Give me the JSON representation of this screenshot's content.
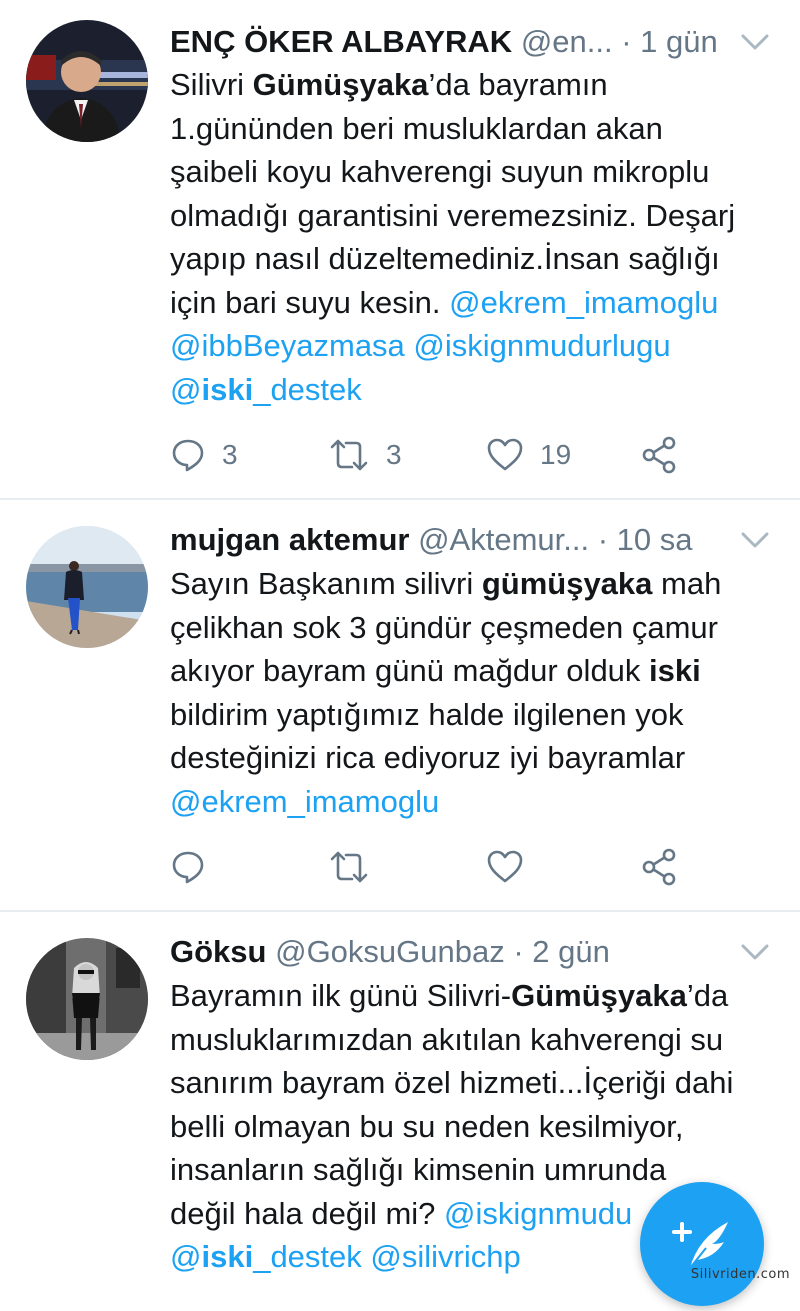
{
  "tweets": [
    {
      "name": "ENÇ ÖKER ALBAYRAK",
      "handle": "@en...",
      "time": "· 1 gün",
      "lines": [
        [
          {
            "t": "Silivri "
          },
          {
            "t": "Gümüşyaka",
            "s": "bold"
          },
          {
            "t": "’da bayramın"
          }
        ],
        [
          {
            "t": "1.gününden beri musluklardan akan"
          }
        ],
        [
          {
            "t": "şaibeli koyu kahverengi suyun mikroplu"
          }
        ],
        [
          {
            "t": "olmadığı garantisini veremezsiniz. Deşarj"
          }
        ],
        [
          {
            "t": "yapıp nasıl düzeltemediniz.İnsan sağlığı"
          }
        ],
        [
          {
            "t": "için bari suyu kesin. "
          },
          {
            "t": "@ekrem_imamoglu",
            "s": "link"
          }
        ],
        [
          {
            "t": "@ibbBeyazmasa @iskignmudurlugu",
            "s": "link"
          }
        ],
        [
          {
            "t": "@",
            "s": "link"
          },
          {
            "t": "iski",
            "s": "linkbold"
          },
          {
            "t": "_destek",
            "s": "link"
          }
        ]
      ],
      "replies": "3",
      "retweets": "3",
      "likes": "19"
    },
    {
      "name": "mujgan aktemur",
      "handle": "@Aktemur...",
      "time": "· 10 sa",
      "lines": [
        [
          {
            "t": "Sayın Başkanım silivri "
          },
          {
            "t": "gümüşyaka",
            "s": "bold"
          },
          {
            "t": " mah"
          }
        ],
        [
          {
            "t": "çelikhan sok 3 gündür çeşmeden çamur"
          }
        ],
        [
          {
            "t": "akıyor bayram günü mağdur olduk "
          },
          {
            "t": "iski",
            "s": "bold"
          }
        ],
        [
          {
            "t": "bildirim yaptığımız halde ilgilenen yok"
          }
        ],
        [
          {
            "t": "desteğinizi rica ediyoruz iyi bayramlar"
          }
        ],
        [
          {
            "t": "@ekrem_imamoglu",
            "s": "link"
          }
        ]
      ],
      "replies": "",
      "retweets": "",
      "likes": ""
    },
    {
      "name": "Göksu",
      "handle": "@GoksuGunbaz",
      "time": "· 2 gün",
      "lines": [
        [
          {
            "t": "Bayramın ilk günü Silivri-"
          },
          {
            "t": "Gümüşyaka",
            "s": "bold"
          },
          {
            "t": "’da"
          }
        ],
        [
          {
            "t": "musluklarımızdan akıtılan kahverengi su"
          }
        ],
        [
          {
            "t": "sanırım bayram özel hizmeti...İçeriği dahi"
          }
        ],
        [
          {
            "t": "belli olmayan bu su neden kesilmiyor,"
          }
        ],
        [
          {
            "t": "insanların sağlığı kimsenin umrunda"
          }
        ],
        [
          {
            "t": "değil hala değil mi? "
          },
          {
            "t": "@iskignmudu",
            "s": "link"
          }
        ],
        [
          {
            "t": "@",
            "s": "link"
          },
          {
            "t": "iski",
            "s": "linkbold"
          },
          {
            "t": "_destek @silivrichp",
            "s": "link"
          }
        ]
      ]
    }
  ],
  "watermark": "Silivriden.com",
  "icons": {
    "reply": "reply-icon",
    "retweet": "retweet-icon",
    "like": "heart-icon",
    "share": "share-icon",
    "caret": "chevron-down-icon",
    "compose": "compose-tweet-icon"
  },
  "colors": {
    "link": "#1da1f2",
    "muted": "#657786",
    "text": "#14171a",
    "divider": "#e6ecf0"
  }
}
